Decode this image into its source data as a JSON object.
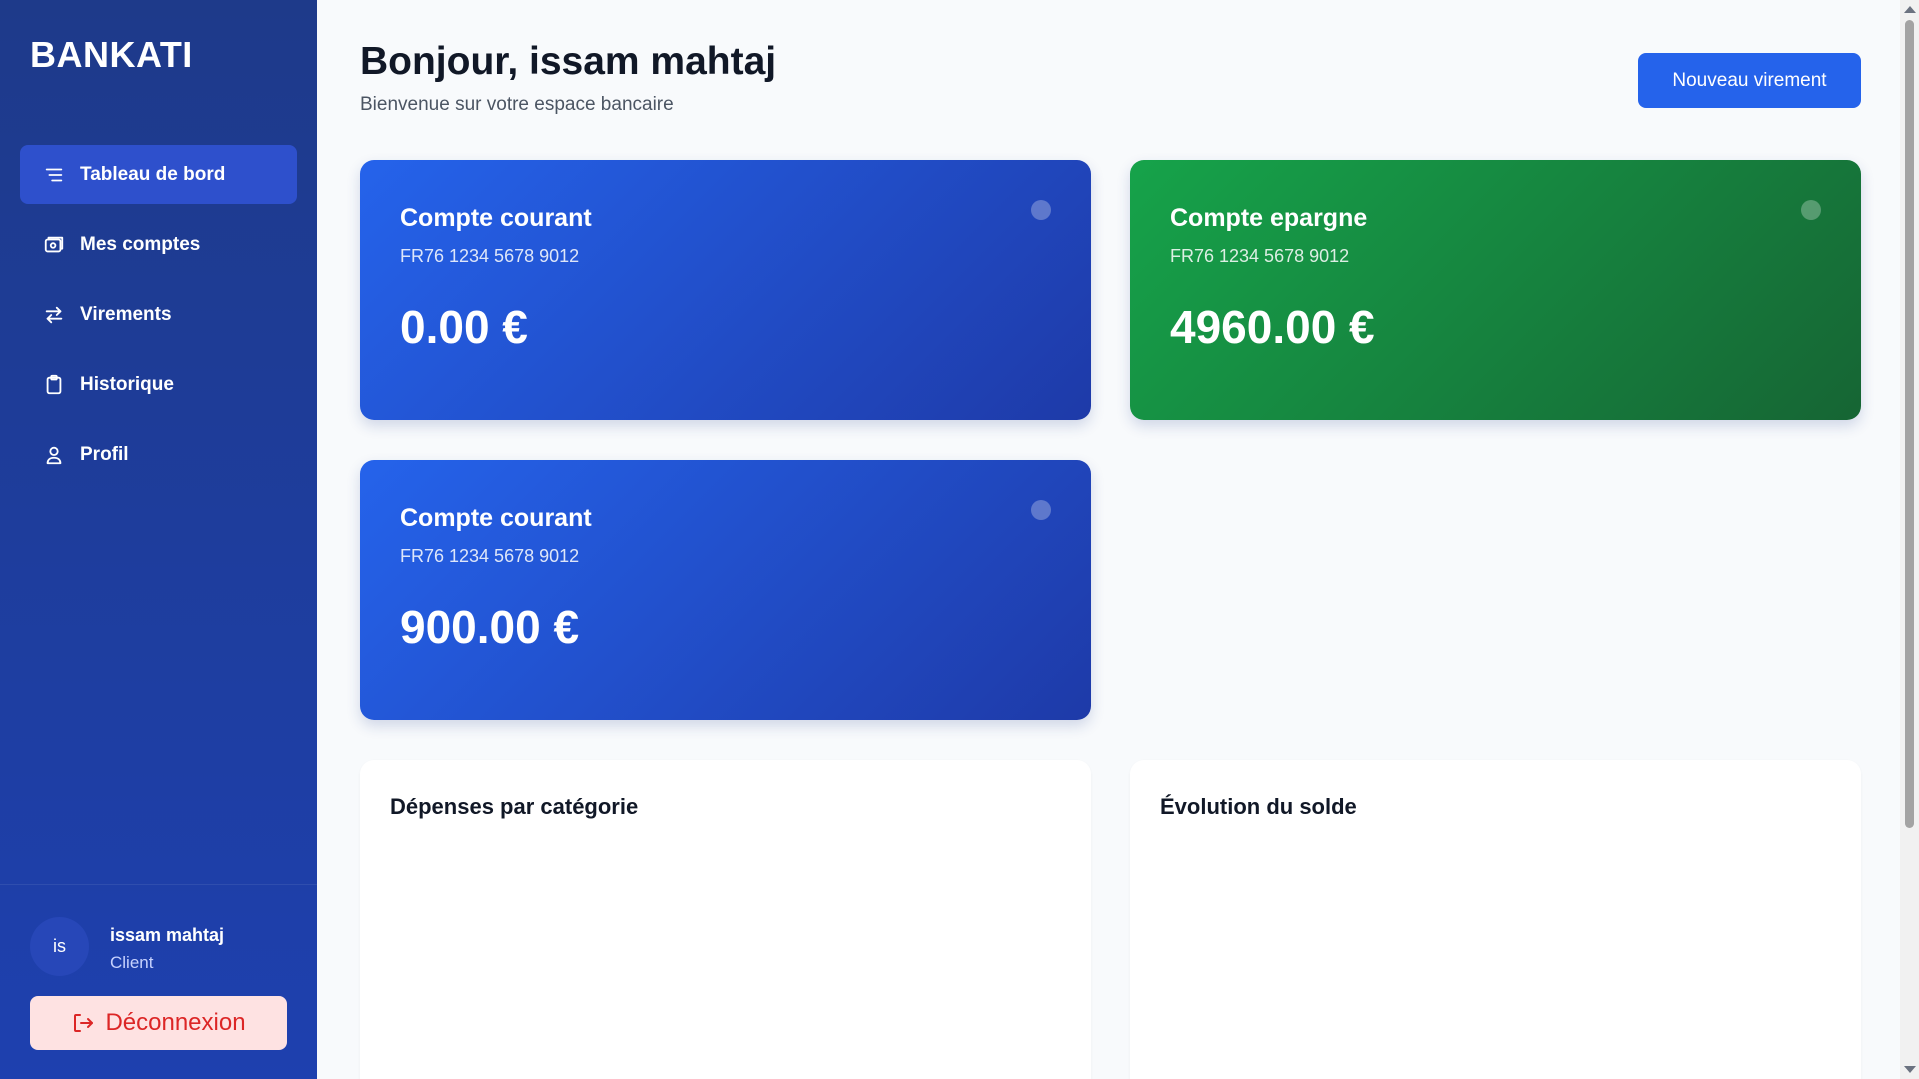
{
  "brand": "BANKATI",
  "nav": [
    {
      "label": "Tableau de bord",
      "icon": "menu-icon",
      "active": true
    },
    {
      "label": "Mes comptes",
      "icon": "wallet-icon",
      "active": false
    },
    {
      "label": "Virements",
      "icon": "transfer-icon",
      "active": false
    },
    {
      "label": "Historique",
      "icon": "clipboard-icon",
      "active": false
    },
    {
      "label": "Profil",
      "icon": "user-icon",
      "active": false
    }
  ],
  "user": {
    "initials": "is",
    "name": "issam mahtaj",
    "role": "Client"
  },
  "logout_label": "Déconnexion",
  "header": {
    "greeting": "Bonjour, issam mahtaj",
    "subtitle": "Bienvenue sur votre espace bancaire",
    "new_transfer_label": "Nouveau virement"
  },
  "accounts": [
    {
      "type": "Compte courant",
      "iban": "FR76 1234 5678 9012",
      "balance": "0.00 €",
      "color": "#2563eb"
    },
    {
      "type": "Compte epargne",
      "iban": "FR76 1234 5678 9012",
      "balance": "4960.00 €",
      "color": "#16a34a"
    },
    {
      "type": "Compte courant",
      "iban": "FR76 1234 5678 9012",
      "balance": "900.00 €",
      "color": "#2563eb"
    }
  ],
  "panels": {
    "expenses_title": "Dépenses par catégorie",
    "balance_title": "Évolution du solde"
  },
  "colors": {
    "sidebar": "#1e3a8a",
    "primary": "#2563eb",
    "savings": "#16a34a",
    "danger": "#dc2626"
  }
}
